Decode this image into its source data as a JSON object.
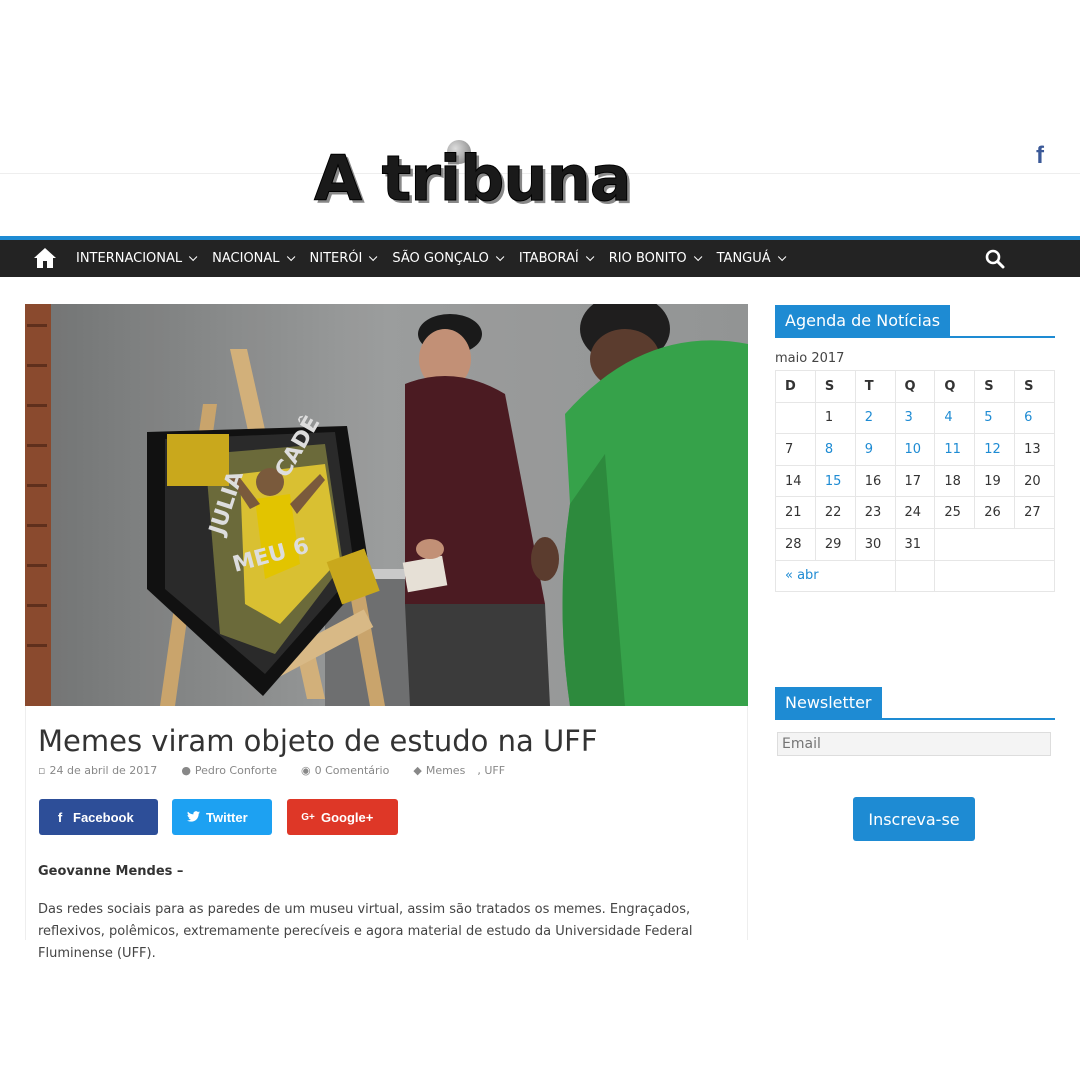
{
  "header": {
    "logo_text": "A tribuna",
    "social_icon": "facebook-icon"
  },
  "nav": {
    "home_icon": "home-icon",
    "items": [
      {
        "label": "INTERNACIONAL"
      },
      {
        "label": "NACIONAL"
      },
      {
        "label": "NITERÓI"
      },
      {
        "label": "SÃO GONÇALO"
      },
      {
        "label": "ITABORAÍ"
      },
      {
        "label": "RIO BONITO"
      },
      {
        "label": "TANGUÁ"
      }
    ],
    "search_icon": "search-icon",
    "accent_color": "#1e8bd3",
    "bar_color": "#232323"
  },
  "article": {
    "image_poster_text": [
      "JULIA",
      "CADÊ",
      "MEU 6"
    ],
    "title": "Memes viram objeto de estudo na UFF",
    "meta": {
      "date": "24 de abril de 2017",
      "author": "Pedro Conforte",
      "comments": "0 Comentário",
      "tags": [
        "Memes",
        "UFF"
      ]
    },
    "share": {
      "facebook": "Facebook",
      "twitter": "Twitter",
      "google": "Google+"
    },
    "byline": "Geovanne Mendes –",
    "body": "Das redes sociais para as paredes de um museu virtual, assim são tratados os memes. Engraçados, reflexivos, polêmicos, extremamente perecíveis e agora material de estudo da Universidade Federal Fluminense (UFF)."
  },
  "sidebar": {
    "agenda_title": "Agenda de Notícias",
    "calendar": {
      "caption": "maio 2017",
      "weekdays": [
        "D",
        "S",
        "T",
        "Q",
        "Q",
        "S",
        "S"
      ],
      "prev_link": "« abr"
    },
    "newsletter_title": "Newsletter",
    "email_placeholder": "Email",
    "subscribe_label": "Inscreva-se"
  }
}
